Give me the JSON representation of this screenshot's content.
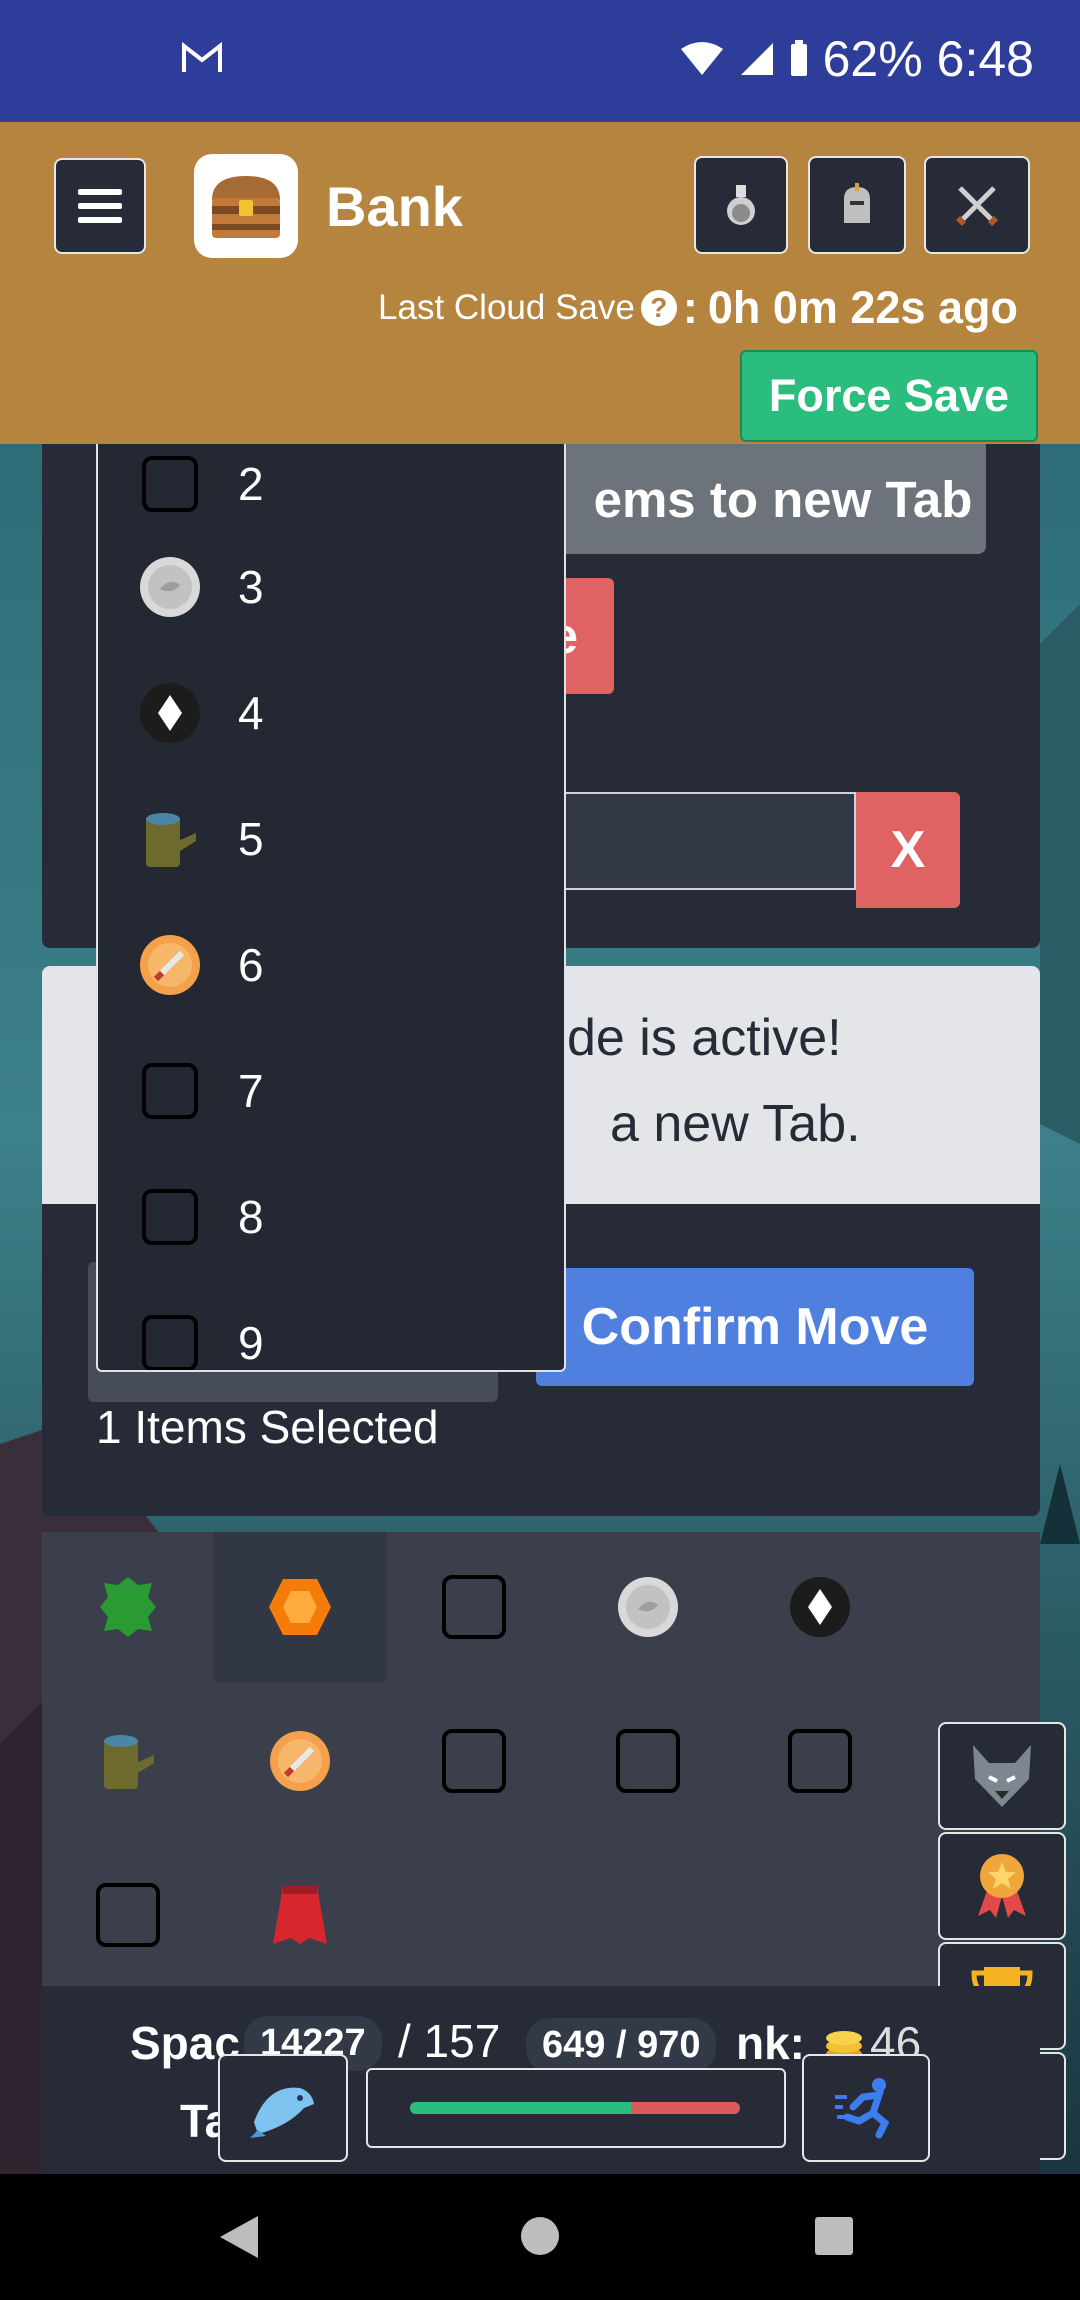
{
  "status_bar": {
    "mail_icon": "gmail-icon",
    "battery": "62%",
    "time": "6:48"
  },
  "header": {
    "title": "Bank",
    "last_save_label": "Last Cloud Save",
    "last_save_value": "0h 0m 22s ago",
    "force_save": "Force Save"
  },
  "panel": {
    "move_tab_button": "ems to new Tab",
    "red_button": "e",
    "clear_button": "X"
  },
  "alert": {
    "line1": "de is active!",
    "line2": "a new Tab."
  },
  "move": {
    "confirm_button": "Confirm Move",
    "selected_text": "1 Items Selected"
  },
  "dropdown": {
    "items": [
      {
        "label": "2",
        "icon": "empty-checkbox"
      },
      {
        "label": "3",
        "icon": "silver-coin-icon"
      },
      {
        "label": "4",
        "icon": "diamond-icon"
      },
      {
        "label": "5",
        "icon": "wood-log-icon"
      },
      {
        "label": "6",
        "icon": "sword-badge-icon"
      },
      {
        "label": "7",
        "icon": "empty-checkbox"
      },
      {
        "label": "8",
        "icon": "empty-checkbox"
      },
      {
        "label": "9",
        "icon": "empty-checkbox"
      }
    ]
  },
  "bank_grid": {
    "items": [
      "green-leather-icon",
      "orange-gem-icon",
      "empty-checkbox",
      "silver-coin-icon",
      "diamond-icon",
      "wood-log-icon",
      "sword-badge-icon",
      "empty-checkbox",
      "empty-checkbox",
      "empty-checkbox",
      "empty-checkbox",
      "red-cape-icon"
    ]
  },
  "footer": {
    "space_text": "Spac",
    "space_value": "14227",
    "space_total": "/ 157",
    "hp": "649 / 970",
    "bank_text": "nk:",
    "gold_value": "46",
    "tab_text": "Ta",
    "hp_fraction": 0.669
  }
}
